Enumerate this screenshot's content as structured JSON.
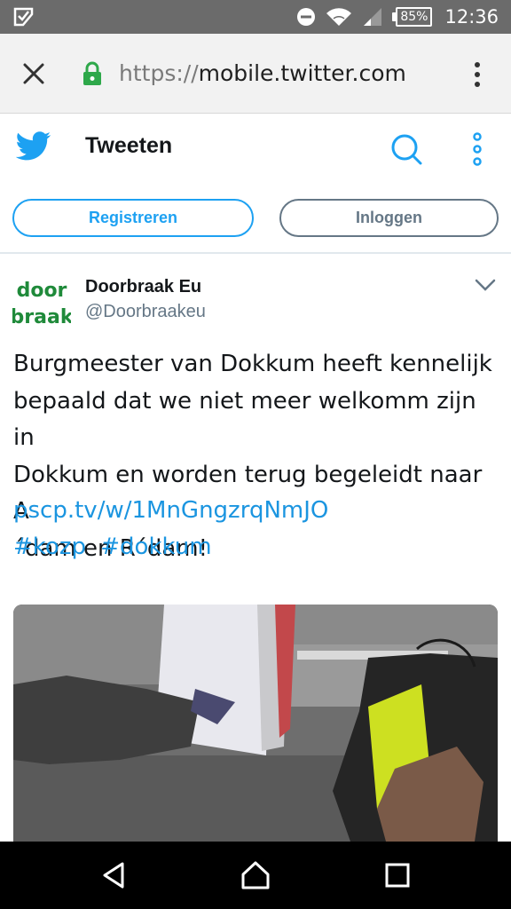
{
  "status_bar": {
    "battery": "85%",
    "time": "12:36",
    "icons": [
      "notification-icon",
      "do-not-disturb-icon",
      "wifi-icon",
      "signal-icon",
      "battery-icon"
    ]
  },
  "browser": {
    "url_scheme": "https://",
    "url_host": "mobile.twitter.com",
    "icons": [
      "close-icon",
      "lock-icon",
      "overflow-menu-icon"
    ]
  },
  "twitter_header": {
    "title": "Tweeten",
    "register_label": "Registreren",
    "login_label": "Inloggen"
  },
  "tweet": {
    "author_name": "Doorbraak Eu",
    "author_handle": "@Doorbraakeu",
    "avatar_text_top": "door",
    "avatar_text_bottom": "braak",
    "text_lines": [
      "Burgmeester van Dokkum heeft kennelijk",
      "bepaald dat we niet meer welkomm zijn in",
      "Dokkum en worden terug begeleidt naar A",
      "´dam en R´dam!"
    ],
    "link": "pscp.tv/w/1MnGngzrqNmJO",
    "hashtags": [
      "#kozp",
      "#dokkum"
    ]
  },
  "colors": {
    "twitter_blue": "#1da1f2",
    "link_blue": "#1b95e0",
    "avatar_green": "#1f8a3a",
    "status_bar": "#6b6b6b"
  }
}
